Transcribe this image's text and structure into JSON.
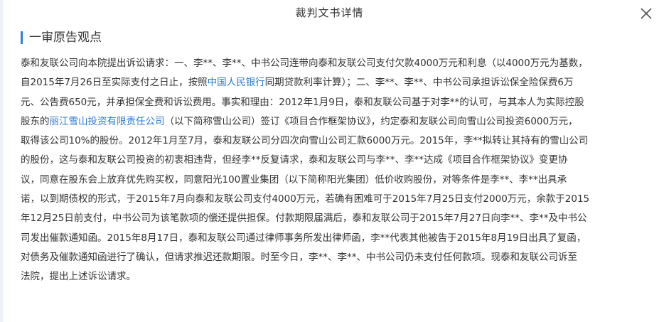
{
  "window": {
    "title": "裁判文书详情"
  },
  "section": {
    "heading": "一审原告观点"
  },
  "body": {
    "lines": [
      [
        {
          "text": "泰和友联公司向本院提出诉讼请求：一、李**、李**、中书公司连带向泰和友联公司支付欠款4000万元和利息（以4000万元为基数，"
        }
      ],
      [
        {
          "text": "自2015年7月26日至实际支付之日止，按照"
        },
        {
          "text": "中国人民银行",
          "link": true
        },
        {
          "text": "同期贷款利率计算）；二、李**、李**、中书公司承担诉讼保全险保费6万"
        }
      ],
      [
        {
          "text": "元、公告费650元，并承担保全费和诉讼费用。事实和理由：2012年1月9日，泰和友联公司基于对李**的认可，与其本人为实际控股"
        }
      ],
      [
        {
          "text": "股东的"
        },
        {
          "text": "丽江雪山投资有限责任公司",
          "link": true
        },
        {
          "text": "（以下简称雪山公司）签订《项目合作框架协议》，约定泰和友联公司向雪山公司投资6000万元，"
        }
      ],
      [
        {
          "text": "取得该公司10%的股份。2012年1月至7月，泰和友联公司分四次向雪山公司汇款6000万元。2015年，李**拟转让其持有的雪山公司"
        }
      ],
      [
        {
          "text": "的股份，这与泰和友联公司投资的初衷相违背，但经李**反复请求，泰和友联公司与李**、李**达成《项目合作框架协议》变更协"
        }
      ],
      [
        {
          "text": "议，同意在股东会上放弃优先购买权，同意阳光100置业集团（以下简称阳光集团）低价收购股份，对等条件是李**、李**出具承"
        }
      ],
      [
        {
          "text": "诺，以到期债权的形式，于2015年7月向泰和友联公司支付4000万元，若确有困难可于2015年7月25日支付2000万元，余款于2015"
        }
      ],
      [
        {
          "text": "年12月25日前支付，中书公司为该笔款项的偿还提供担保。付款期限届满后，泰和友联公司于2015年7月27日向李**、李**及中书公"
        }
      ],
      [
        {
          "text": "司发出催款通知函。2015年8月17日，泰和友联公司通过律师事务所发出律师函，李**代表其他被告于2015年8月19日出具了复函，"
        }
      ],
      [
        {
          "text": "对债务及催款通知函进行了确认，但请求推迟还款期限。时至今日，李**、李**、中书公司仍未支付任何款项。现泰和友联公司诉至"
        }
      ],
      [
        {
          "text": "法院，提出上述诉讼请求。"
        }
      ]
    ]
  },
  "colors": {
    "accent": "#2e7fd6",
    "link": "#2b7bd3",
    "text": "#333333"
  },
  "icons": {
    "close": "close-icon"
  }
}
